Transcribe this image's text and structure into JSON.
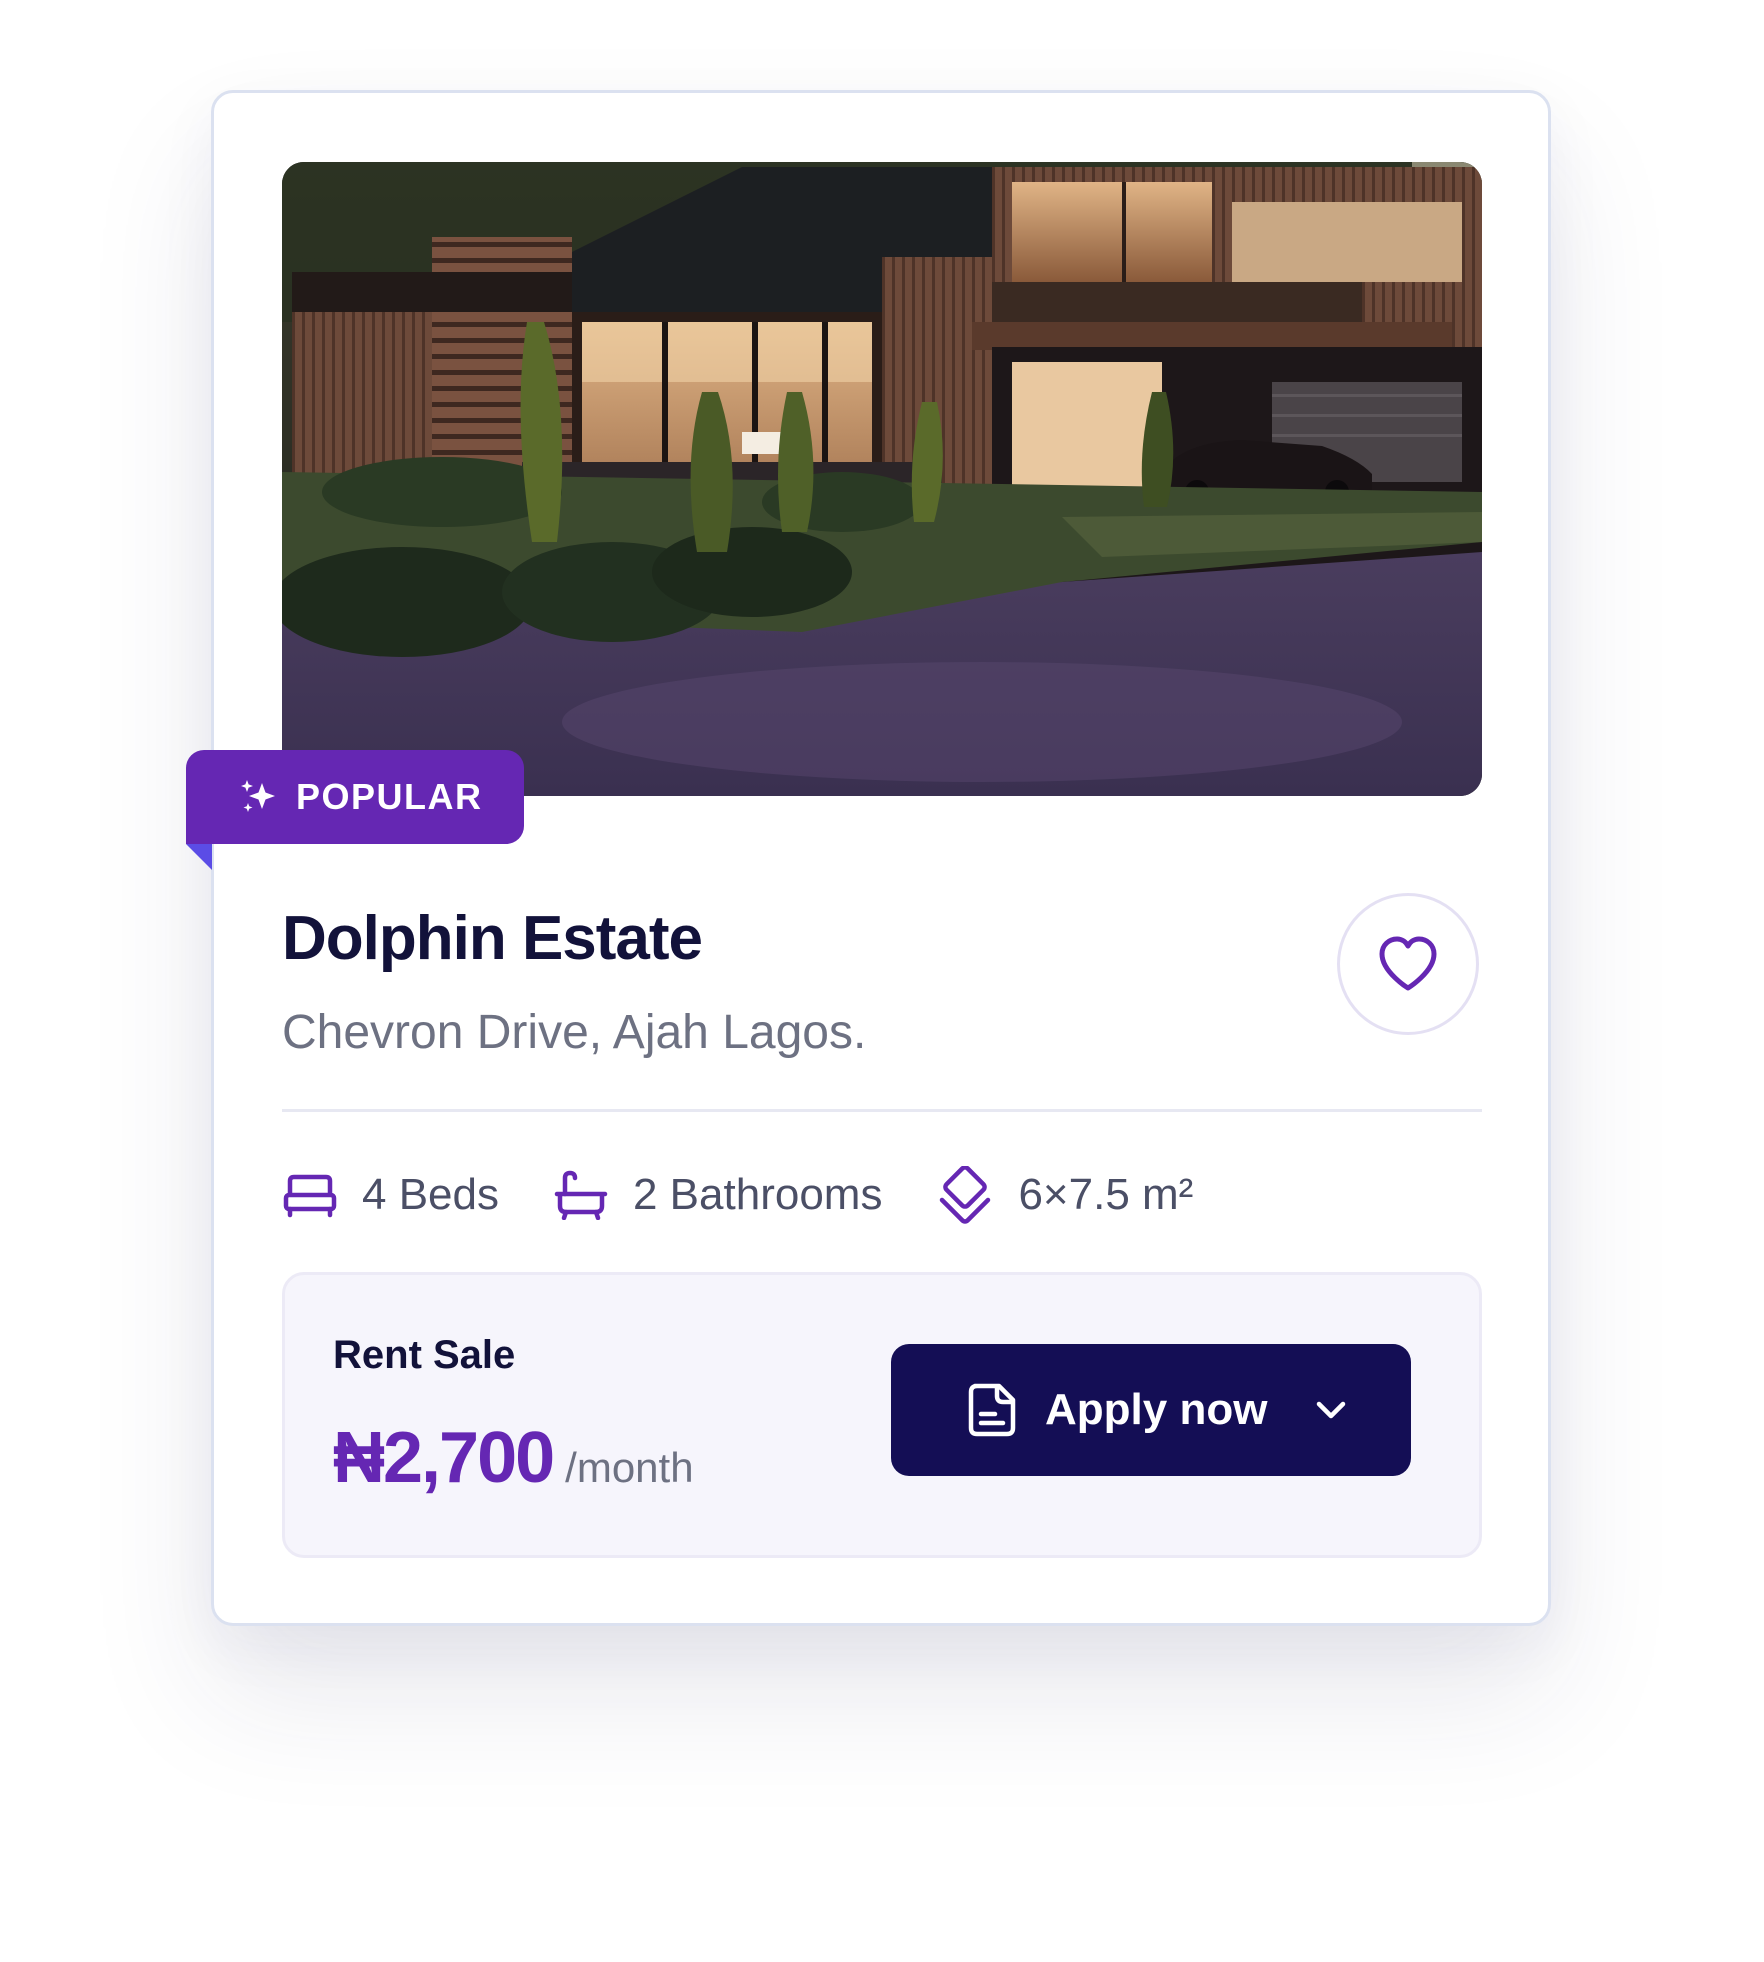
{
  "listing": {
    "badge": {
      "label": "POPULAR",
      "icon": "sparkles-icon"
    },
    "photo": {
      "icon": "house-photo"
    },
    "title": "Dolphin Estate",
    "address": "Chevron Drive, Ajah Lagos.",
    "favorite_icon": "heart-icon",
    "features": [
      {
        "icon": "bed-icon",
        "label": "4 Beds"
      },
      {
        "icon": "bathtub-icon",
        "label": "2 Bathrooms"
      },
      {
        "icon": "area-icon",
        "label": "6×7.5 m²"
      }
    ],
    "pricing": {
      "label": "Rent Sale",
      "amount": "₦2,700",
      "unit": "/month"
    },
    "apply_button": {
      "label": "Apply now",
      "icon": "document-icon",
      "chevron": "chevron-down-icon"
    }
  },
  "colors": {
    "accent": "#6527b3",
    "button": "#140e55",
    "title": "#12123a",
    "muted": "#6d7182",
    "border": "#dbe1f0"
  }
}
